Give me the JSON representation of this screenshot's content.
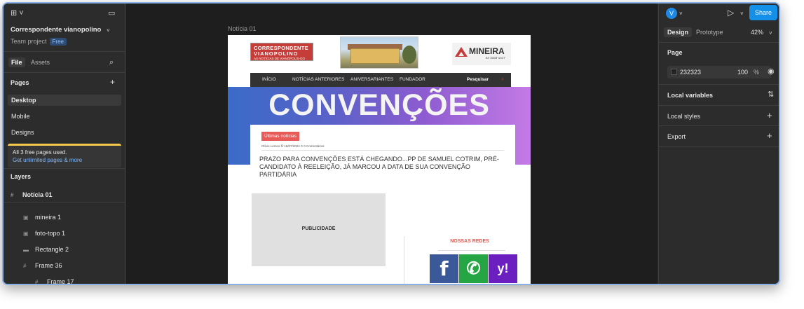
{
  "app": {
    "project_name": "Correspondente vianopolino",
    "team_label": "Team project",
    "plan_badge": "Free"
  },
  "left_panel": {
    "tabs": [
      "File",
      "Assets"
    ],
    "pages_heading": "Pages",
    "pages": [
      "Desktop",
      "Mobile",
      "Designs"
    ],
    "upgrade_banner": {
      "text": "All 3 free pages used.",
      "link": "Get unlimited pages & more"
    },
    "layers_heading": "Layers",
    "layers": [
      {
        "name": "Notícia 01",
        "icon": "frame-icon",
        "level": 0
      },
      {
        "name": "mineira 1",
        "icon": "image-icon",
        "level": 1
      },
      {
        "name": "foto-topo 1",
        "icon": "image-icon",
        "level": 1
      },
      {
        "name": "Rectangle 2",
        "icon": "rectangle-icon",
        "level": 1
      },
      {
        "name": "Frame 36",
        "icon": "frame-icon",
        "level": 1
      },
      {
        "name": "Frame 17",
        "icon": "frame-icon",
        "level": 2
      }
    ]
  },
  "canvas": {
    "frame_label": "Notícia 01",
    "site": {
      "logo_lines": [
        "CORRESPONDENTE",
        "VIANOPOLINO",
        "AS NOTÍCIAS DE VIANÓPOLIS-GO"
      ],
      "ad_title": "MINEIRA",
      "ad_sub": "64 3333-1417",
      "nav": [
        "INÍCIO",
        "NOTÍCIAS ANTERIORES",
        "ANIVERSARIANTES",
        "FUNDADOR"
      ],
      "search_label": "Pesquisar",
      "hero_word": "CONVENÇÕES",
      "category_tag": "Últimas notícias",
      "meta": "Olívio Lemos   ⏲ 16/07/2024   ⊙ 0 Comentários",
      "headline": "PRAZO PARA CONVENÇÕES ESTÁ CHEGANDO...PP DE SAMUEL COTRIM, PRÉ-CANDIDATO À REELEIÇÃO, JÁ MARCOU A DATA DE SUA CONVENÇÃO PARTIDÁRIA",
      "ad_block": "PUBLICIDADE",
      "social_heading": "NOSSAS REDES",
      "social": [
        "f",
        "✆",
        "y!"
      ]
    }
  },
  "right_panel": {
    "avatar_letter": "V",
    "share_label": "Share",
    "tabs": [
      "Design",
      "Prototype"
    ],
    "zoom": "42%",
    "page_heading": "Page",
    "bg_hex": "232323",
    "bg_opacity": "100",
    "percent_sign": "%",
    "sections": [
      "Local variables",
      "Local styles",
      "Export"
    ]
  },
  "colors": {
    "ui_bg": "#2c2c2c",
    "canvas_bg": "#1e1e1e",
    "accent": "#1590e8",
    "site_red": "#c63c38"
  }
}
